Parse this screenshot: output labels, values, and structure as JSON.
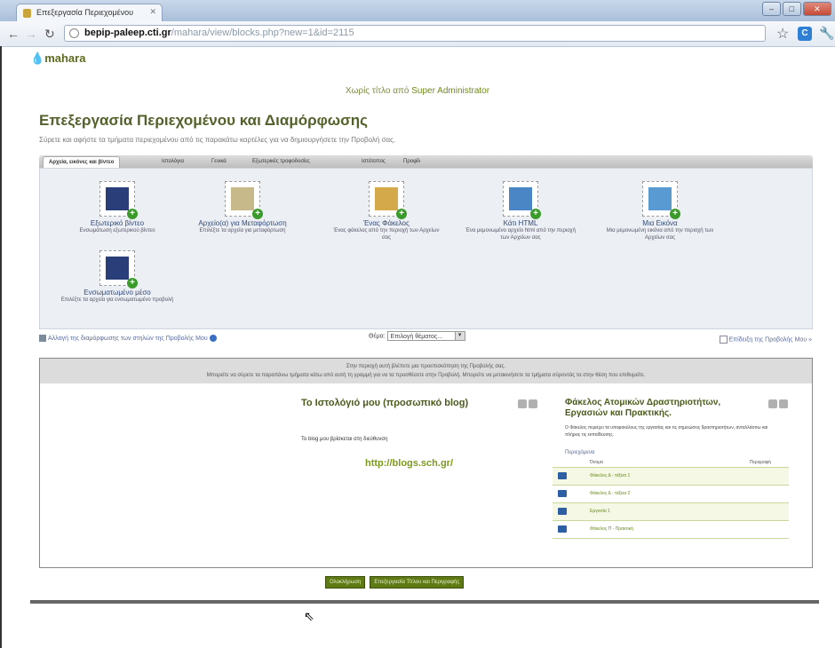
{
  "window": {
    "tab_title": "Επεξεργασία Περιεχομένου",
    "min": "–",
    "max": "□",
    "close": "✕"
  },
  "browser": {
    "url_domain": "bepip-paleep.cti.gr",
    "url_path": "/mahara/view/blocks.php?new=1&id=2115"
  },
  "site": {
    "logo": "mahara"
  },
  "topnav": {
    "prefix": "Χωρίς τίτλο",
    "middle": " από ",
    "user": "Super Administrator"
  },
  "page": {
    "title": "Επεξεργασία Περιεχομένου και Διαμόρφωσης",
    "subtitle": "Σύρετε και αφήστε τα τμήματα περιεχομένου από τις παρακάτω καρτέλες για να δημιουργήσετε την Προβολή σας."
  },
  "tabs": [
    {
      "label": "Αρχεία, εικόνες και βίντεο"
    },
    {
      "label": "Ιστολόγια"
    },
    {
      "label": "Γενικά"
    },
    {
      "label": "Εξωτερικές τροφοδοσίες"
    },
    {
      "label": "Ιστότοπος"
    },
    {
      "label": "Προφίλ"
    }
  ],
  "blocks": [
    {
      "title": "Εξωτερικό βίντεο",
      "desc": "Ενσωμάτωση εξωτερικού βίντεο"
    },
    {
      "title": "Αρχείο(α) για Μεταφόρτωση",
      "desc": "Επιλέξτε τα αρχεία για μεταφόρτωση"
    },
    {
      "title": "Ένας Φάκελος",
      "desc": "Ένας φάκελος από την περιοχή των Αρχείων σας"
    },
    {
      "title": "Κάτι HTML",
      "desc": "Ένα μεμονωμένο αρχείο html από την περιοχή των Αρχείων σας"
    },
    {
      "title": "Μια Εικόνα",
      "desc": "Μια μεμονωμένη εικόνα από την περιοχή των Αρχείων σας"
    },
    {
      "title": "Ενσωματωμένο μέσο",
      "desc": "Επιλέξτε τα αρχεία για ενσωματωμένο προβολή"
    }
  ],
  "below": {
    "layout_link": "Αλλαγή της διαμόρφωσης των στηλών της Προβολής Μου",
    "theme_label": "Θέμα:",
    "theme_value": "Επιλογή θέματος...",
    "view_link": "Επίδειξη της Προβολής Μου »"
  },
  "canvas": {
    "info1": "Στην περιοχή αυτή βλέπετε μια προεπισκόπηση της Προβολής σας.",
    "info2": "Μπορείτε να σύρετε τα παραπάνω τμήματα κάτω από αυτή τη γραμμή για να τα προσθέσετε στην Προβολή. Μπορείτε να μετακινήσετε τα τμήματα σύροντάς τα στην θέση που επιθυμείτε.",
    "blog_title": "Το Ιστολόγιό μου (προσωπικό blog)",
    "blog_text": "Το blog μου βρίσκεται στη διεύθυνση",
    "blog_url": "http://blogs.sch.gr/",
    "folder_title": "Φάκελος Ατομικών Δραστηριοτήτων, Εργασιών και Πρακτικής.",
    "folder_desc": "Ο Φάκελος περιέχει τα υποφακέλους της εργασίας και τις σημειώσεις δραστηριοτήτων, ανταλλάσσω και πλήρεις τις εκπαίδευσης.",
    "contents_label": "Περιεχόμενα",
    "col_name": "Όνομα",
    "col_desc": "Περιγραφή",
    "files": [
      "Φάκελος Δ - τάξεια 1",
      "Φάκελος Δ - τάξεια 2",
      "Εργασία 1",
      "Φάκελος Π - Πρακτική"
    ]
  },
  "buttons": {
    "done": "Ολοκλήρωση",
    "edit_title": "Επεξεργασία Τίτλου και Περιγραφής"
  }
}
